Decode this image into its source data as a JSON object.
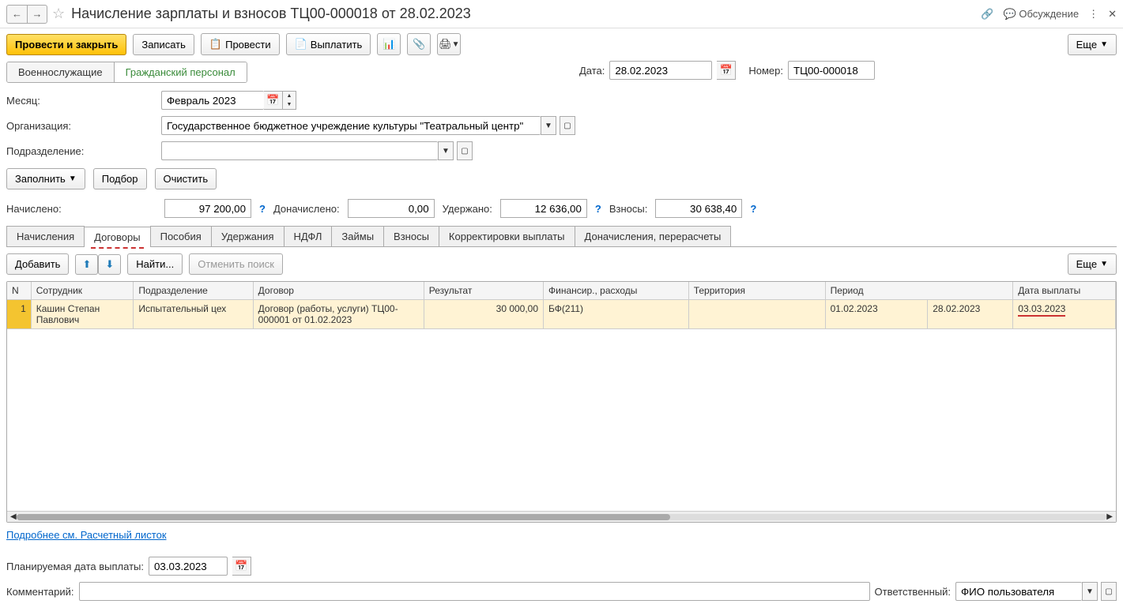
{
  "header": {
    "title": "Начисление зарплаты и взносов ТЦ00-000018 от 28.02.2023",
    "discussion": "Обсуждение"
  },
  "toolbar": {
    "post_close": "Провести и закрыть",
    "save": "Записать",
    "post": "Провести",
    "pay": "Выплатить",
    "more": "Еще"
  },
  "seg": {
    "military": "Военнослужащие",
    "civil": "Гражданский персонал"
  },
  "doc": {
    "date_label": "Дата:",
    "date": "28.02.2023",
    "number_label": "Номер:",
    "number": "ТЦ00-000018"
  },
  "fields": {
    "month_label": "Месяц:",
    "month": "Февраль 2023",
    "org_label": "Организация:",
    "org": "Государственное бюджетное учреждение культуры \"Театральный центр\"",
    "dept_label": "Подразделение:",
    "dept": ""
  },
  "actions": {
    "fill": "Заполнить",
    "pick": "Подбор",
    "clear": "Очистить"
  },
  "totals": {
    "accrued_label": "Начислено:",
    "accrued": "97 200,00",
    "extra_label": "Доначислено:",
    "extra": "0,00",
    "withheld_label": "Удержано:",
    "withheld": "12 636,00",
    "contrib_label": "Взносы:",
    "contrib": "30 638,40"
  },
  "tabs": {
    "t0": "Начисления",
    "t1": "Договоры",
    "t2": "Пособия",
    "t3": "Удержания",
    "t4": "НДФЛ",
    "t5": "Займы",
    "t6": "Взносы",
    "t7": "Корректировки выплаты",
    "t8": "Доначисления, перерасчеты"
  },
  "subbar": {
    "add": "Добавить",
    "find": "Найти...",
    "cancel_find": "Отменить поиск",
    "more": "Еще"
  },
  "grid": {
    "headers": {
      "n": "N",
      "emp": "Сотрудник",
      "dept": "Подразделение",
      "contract": "Договор",
      "result": "Результат",
      "fin": "Финансир., расходы",
      "terr": "Территория",
      "period": "Период",
      "paydate": "Дата выплаты"
    },
    "row1": {
      "n": "1",
      "emp": "Кашин Степан Павлович",
      "dept": "Испытательный цех",
      "contract": "Договор (работы, услуги) ТЦ00-000001 от 01.02.2023",
      "result": "30 000,00",
      "fin": "БФ(211)",
      "terr": "",
      "period_from": "01.02.2023",
      "period_to": "28.02.2023",
      "paydate": "03.03.2023"
    }
  },
  "link": "Подробнее см. Расчетный листок",
  "footer": {
    "planned_label": "Планируемая дата выплаты:",
    "planned": "03.03.2023",
    "comment_label": "Комментарий:",
    "comment": "",
    "resp_label": "Ответственный:",
    "resp": "ФИО пользователя"
  }
}
